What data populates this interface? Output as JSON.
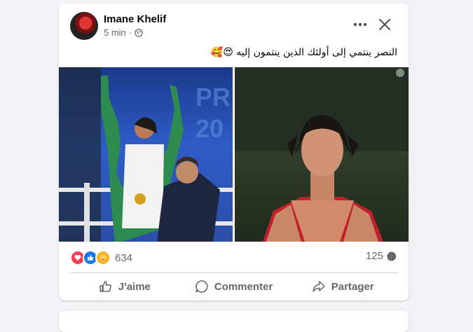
{
  "post": {
    "author": "Imane Khelif",
    "time": "5 min",
    "privacy_icon": "globe-icon",
    "text": "النصر ينتمي إلى أولئك الذين ينتمون إليه 😍🥰",
    "reactions": {
      "icons": [
        "heart-react-icon",
        "like-react-icon",
        "care-react-icon"
      ],
      "count": "634"
    },
    "comments_count": "125",
    "actions": {
      "like": "J'aime",
      "comment": "Commenter",
      "share": "Partager"
    }
  },
  "colors": {
    "page_bg": "#f0f2f5",
    "card_bg": "#ffffff",
    "secondary_text": "#65676b",
    "like_blue": "#1877f2",
    "love_red": "#f33e58"
  }
}
